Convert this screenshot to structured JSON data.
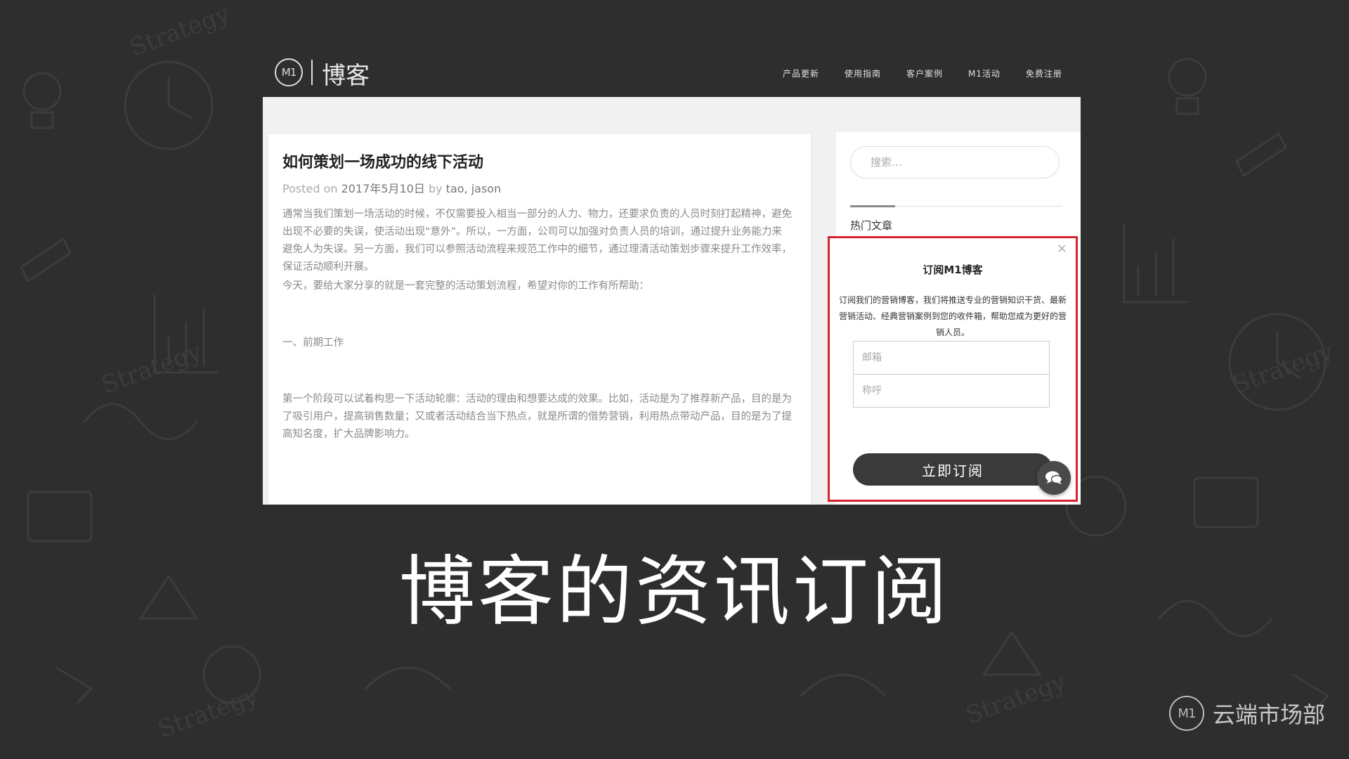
{
  "site": {
    "logo_mark": "M1",
    "logo_text": "博客",
    "nav": [
      "产品更新",
      "使用指南",
      "客户案例",
      "M1活动",
      "免费注册"
    ]
  },
  "article": {
    "title": "如何策划一场成功的线下活动",
    "meta_posted": "Posted on",
    "meta_date": "2017年5月10日",
    "meta_by": "by",
    "meta_authors": "tao, jason",
    "paragraphs": [
      "通常当我们策划一场活动的时候，不仅需要投入相当一部分的人力、物力，还要求负责的人员时刻打起精神，避免出现不必要的失误，使活动出现“意外”。所以，一方面，公司可以加强对负责人员的培训，通过提升业务能力来避免人为失误。另一方面，我们可以参照活动流程来规范工作中的细节，通过理清活动策划步骤来提升工作效率，保证活动顺利开展。",
      "今天，要给大家分享的就是一套完整的活动策划流程，希望对你的工作有所帮助：",
      "一、前期工作",
      "第一个阶段可以试着构思一下活动轮廓：活动的理由和想要达成的效果。比如，活动是为了推荐新产品，目的是为了吸引用户，提高销售数量；又或者活动结合当下热点，就是所谓的借势营销，利用热点带动产品，目的是为了提高知名度，扩大品牌影响力。"
    ]
  },
  "sidebar": {
    "search_placeholder": "搜索…",
    "widget_title": "热门文章"
  },
  "popup": {
    "close": "×",
    "title": "订阅M1博客",
    "description": "订阅我们的营销博客，我们将推送专业的营销知识干货、最新营销活动、经典营销案例到您的收件箱，帮助您成为更好的营销人员。",
    "email_placeholder": "邮箱",
    "name_placeholder": "称呼",
    "button": "立即订阅"
  },
  "caption": "博客的资讯订阅",
  "brand": {
    "mark": "M1",
    "text": "云端市场部"
  },
  "colors": {
    "background": "#2e2e2e",
    "highlight_border": "#d6222c",
    "button": "#3a3a3a"
  },
  "icons": {
    "chat": "chat-bubble-icon",
    "close": "close-icon"
  }
}
